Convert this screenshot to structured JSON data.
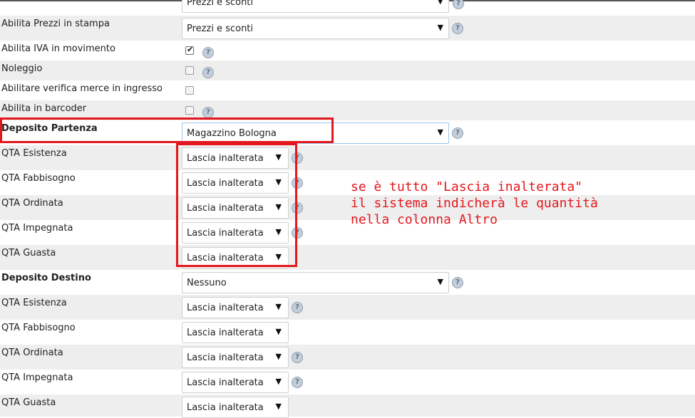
{
  "top_row": {
    "value": "Prezzi e sconti"
  },
  "rows": {
    "prezzi_stampa": {
      "label": "Abilita Prezzi in stampa",
      "value": "Prezzi e sconti"
    },
    "iva_movimento": {
      "label": "Abilita IVA in movimento",
      "checked": true
    },
    "noleggio": {
      "label": "Noleggio",
      "checked": false
    },
    "verifica_merce": {
      "label": "Abilitare verifica merce in ingresso",
      "checked": false
    },
    "barcoder": {
      "label": "Abilita in barcoder",
      "checked": false
    }
  },
  "deposito_partenza": {
    "label": "Deposito Partenza",
    "value": "Magazzino Bologna",
    "qta": [
      {
        "label": "QTA Esistenza",
        "value": "Lascia inalterata"
      },
      {
        "label": "QTA Fabbisogno",
        "value": "Lascia inalterata"
      },
      {
        "label": "QTA Ordinata",
        "value": "Lascia inalterata"
      },
      {
        "label": "QTA Impegnata",
        "value": "Lascia inalterata"
      },
      {
        "label": "QTA Guasta",
        "value": "Lascia inalterata"
      }
    ]
  },
  "deposito_destino": {
    "label": "Deposito Destino",
    "value": "Nessuno",
    "qta": [
      {
        "label": "QTA Esistenza",
        "value": "Lascia inalterata"
      },
      {
        "label": "QTA Fabbisogno",
        "value": "Lascia inalterata"
      },
      {
        "label": "QTA Ordinata",
        "value": "Lascia inalterata"
      },
      {
        "label": "QTA Impegnata",
        "value": "Lascia inalterata"
      },
      {
        "label": "QTA Guasta",
        "value": "Lascia inalterata"
      }
    ]
  },
  "annotation": {
    "line1": "se è tutto \"Lascia inalterata\"",
    "line2": "il sistema indicherà le quantità",
    "line3": "nella colonna Altro"
  },
  "icons": {
    "help": "help-question-icon",
    "checkmark": "checkmark-icon",
    "dropdown": "dropdown-arrow-icon"
  },
  "colors": {
    "annotation": "#e3171d",
    "row_alt": "#eeeeee",
    "help_icon": "#c3ced9"
  },
  "glyphs": {
    "arrow": "▼",
    "help": "?",
    "tick": "✔"
  }
}
